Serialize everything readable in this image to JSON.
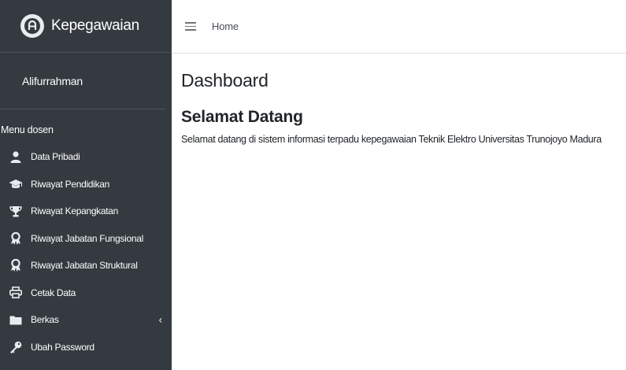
{
  "brand": {
    "title": "Kepegawaian",
    "logo_icon": "circle-a-logo-icon"
  },
  "user": {
    "name": "Alifurrahman"
  },
  "sidebar": {
    "header": "Menu dosen",
    "items": [
      {
        "label": "Data Pribadi",
        "icon": "user-icon"
      },
      {
        "label": "Riwayat Pendidikan",
        "icon": "graduation-cap-icon"
      },
      {
        "label": "Riwayat Kepangkatan",
        "icon": "trophy-icon"
      },
      {
        "label": "Riwayat Jabatan Fungsional",
        "icon": "award-icon"
      },
      {
        "label": "Riwayat Jabatan Struktural",
        "icon": "award-icon"
      },
      {
        "label": "Cetak Data",
        "icon": "print-icon"
      },
      {
        "label": "Berkas",
        "icon": "folder-icon",
        "caret": "‹"
      },
      {
        "label": "Ubah Password",
        "icon": "key-icon"
      }
    ]
  },
  "topbar": {
    "home_label": "Home"
  },
  "main": {
    "page_title": "Dashboard",
    "welcome_title": "Selamat Datang",
    "welcome_text": "Selamat datang di sistem informasi terpadu kepegawaian Teknik Elektro Universitas Trunojoyo Madura"
  },
  "colors": {
    "sidebar_bg": "#343a40",
    "text_light": "#ffffff",
    "content_text": "#212529"
  }
}
